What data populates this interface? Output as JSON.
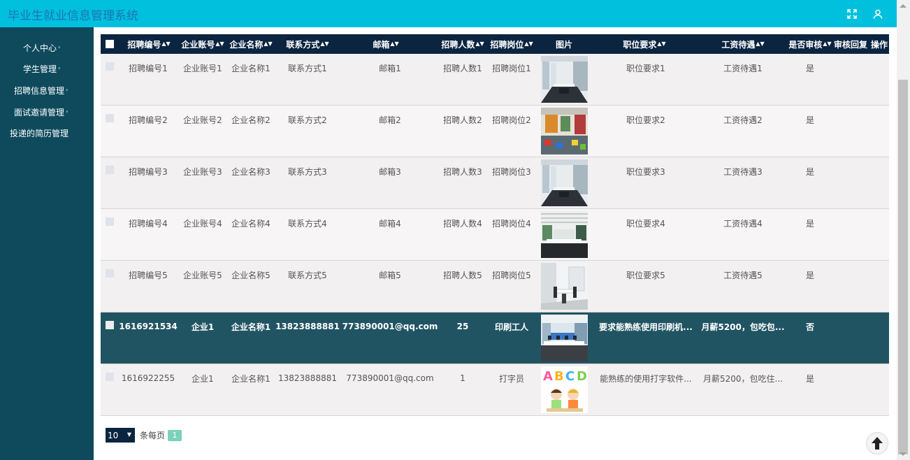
{
  "app_title": "毕业生就业信息管理系统",
  "icons": {
    "fullscreen": "fullscreen-icon",
    "user": "user-icon",
    "back_to_top": "arrow-up-icon"
  },
  "colors": {
    "topbar": "#00c0de",
    "sidebar": "#0e4a5c",
    "header": "#0b2440",
    "selected_row": "#215463",
    "pager_number": "#7bd1bb"
  },
  "sidebar": {
    "items": [
      {
        "label": "个人中心",
        "dropdown": true
      },
      {
        "label": "学生管理",
        "dropdown": true
      },
      {
        "label": "招聘信息管理",
        "dropdown": true
      },
      {
        "label": "面试邀请管理",
        "dropdown": true
      },
      {
        "label": "投递的简历管理",
        "dropdown": false
      }
    ]
  },
  "table": {
    "columns": [
      {
        "key": "id",
        "label": "招聘编号",
        "sortable": true
      },
      {
        "key": "account",
        "label": "企业账号",
        "sortable": true
      },
      {
        "key": "company",
        "label": "企业名称",
        "sortable": true
      },
      {
        "key": "contact",
        "label": "联系方式",
        "sortable": true
      },
      {
        "key": "email",
        "label": "邮箱",
        "sortable": true
      },
      {
        "key": "count",
        "label": "招聘人数",
        "sortable": true
      },
      {
        "key": "position",
        "label": "招聘岗位",
        "sortable": true
      },
      {
        "key": "image",
        "label": "图片",
        "sortable": false
      },
      {
        "key": "requirement",
        "label": "职位要求",
        "sortable": true
      },
      {
        "key": "salary",
        "label": "工资待遇",
        "sortable": true
      },
      {
        "key": "audited",
        "label": "是否审核",
        "sortable": true
      },
      {
        "key": "reply",
        "label": "审核回复",
        "sortable": false
      },
      {
        "key": "ops",
        "label": "操作",
        "sortable": false
      }
    ],
    "rows": [
      {
        "id": "招聘编号1",
        "account": "企业账号1",
        "company": "企业名称1",
        "contact": "联系方式1",
        "email": "邮箱1",
        "count": "招聘人数1",
        "position": "招聘岗位1",
        "image": "office-photo",
        "requirement": "职位要求1",
        "salary": "工资待遇1",
        "audited": "是",
        "reply": "",
        "selected": false
      },
      {
        "id": "招聘编号2",
        "account": "企业账号2",
        "company": "企业名称2",
        "contact": "联系方式2",
        "email": "邮箱2",
        "count": "招聘人数2",
        "position": "招聘岗位2",
        "image": "lounge-photo",
        "requirement": "职位要求2",
        "salary": "工资待遇2",
        "audited": "是",
        "reply": "",
        "selected": false
      },
      {
        "id": "招聘编号3",
        "account": "企业账号3",
        "company": "企业名称3",
        "contact": "联系方式3",
        "email": "邮箱3",
        "count": "招聘人数3",
        "position": "招聘岗位3",
        "image": "office-photo",
        "requirement": "职位要求3",
        "salary": "工资待遇3",
        "audited": "是",
        "reply": "",
        "selected": false
      },
      {
        "id": "招聘编号4",
        "account": "企业账号4",
        "company": "企业名称4",
        "contact": "联系方式4",
        "email": "邮箱4",
        "count": "招聘人数4",
        "position": "招聘岗位4",
        "image": "openspace-photo",
        "requirement": "职位要求4",
        "salary": "工资待遇4",
        "audited": "是",
        "reply": "",
        "selected": false
      },
      {
        "id": "招聘编号5",
        "account": "企业账号5",
        "company": "企业名称5",
        "contact": "联系方式5",
        "email": "邮箱5",
        "count": "招聘人数5",
        "position": "招聘岗位5",
        "image": "meeting-room-photo",
        "requirement": "职位要求5",
        "salary": "工资待遇5",
        "audited": "是",
        "reply": "",
        "selected": false
      },
      {
        "id": "1616921534",
        "account": "企业1",
        "company": "企业名称1",
        "contact": "13823888881",
        "email": "773890001@qq.com",
        "count": "25",
        "position": "印刷工人",
        "image": "workstation-photo",
        "requirement": "要求能熟练使用印刷机...",
        "salary": "月薪5200，包吃包...",
        "audited": "否",
        "reply": "",
        "selected": true
      },
      {
        "id": "1616922255",
        "account": "企业1",
        "company": "企业名称1",
        "contact": "13823888881",
        "email": "773890001@qq.com",
        "count": "1",
        "position": "打字员",
        "image": "abcd-kids-illustration",
        "requirement": "能熟练的使用打字软件...",
        "salary": "月薪5200，包吃住...",
        "audited": "是",
        "reply": "",
        "selected": false
      }
    ]
  },
  "pager": {
    "page_size": "10",
    "per_page_label": "条每页",
    "current_page": "1"
  }
}
